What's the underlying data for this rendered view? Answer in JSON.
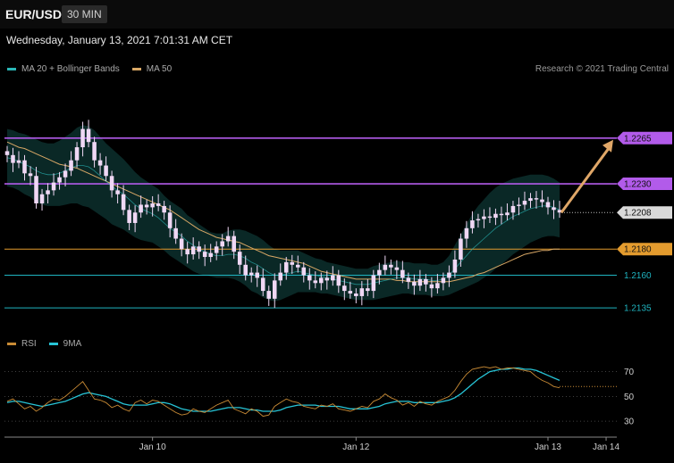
{
  "header": {
    "symbol": "EUR/USD",
    "timeframe": "30 MIN",
    "datetime": "Wednesday, January 13, 2021 7:01:31 AM CET",
    "credit": "Research © 2021 Trading Central"
  },
  "colors": {
    "bollinger": "#2ab7b7",
    "ma50": "#d9a866",
    "resistance": "#b25bea",
    "support_gold": "#e39b2e",
    "support_teal": "#1fb4c0",
    "candle": "#f0d8f5",
    "rsi": "#c98b35",
    "rsi_ma": "#27c4d6",
    "arrow": "#e0a768"
  },
  "chart_data": [
    {
      "type": "candlestick",
      "title": "EUR/USD 30 MIN",
      "ylim": [
        1.2118,
        1.2312
      ],
      "legend": [
        {
          "name": "MA 20 + Bollinger Bands",
          "color": "#2ab7b7"
        },
        {
          "name": "MA 50",
          "color": "#d9a866"
        }
      ],
      "x_ticks": [
        {
          "label": "Jan 10",
          "index": 25
        },
        {
          "label": "Jan 12",
          "index": 60
        },
        {
          "label": "Jan 13",
          "index": 93
        },
        {
          "label": "Jan 14",
          "index": 103
        }
      ],
      "close": [
        1.2252,
        1.2246,
        1.2248,
        1.2238,
        1.2236,
        1.2215,
        1.2222,
        1.2225,
        1.2231,
        1.2235,
        1.224,
        1.2248,
        1.2258,
        1.2272,
        1.2262,
        1.2248,
        1.2244,
        1.2236,
        1.2225,
        1.2222,
        1.221,
        1.22,
        1.2208,
        1.2214,
        1.2212,
        1.2215,
        1.2213,
        1.2208,
        1.2196,
        1.2188,
        1.218,
        1.2176,
        1.2182,
        1.2178,
        1.2174,
        1.2177,
        1.2182,
        1.2186,
        1.219,
        1.2178,
        1.2168,
        1.216,
        1.2162,
        1.2158,
        1.2148,
        1.2142,
        1.2156,
        1.2162,
        1.217,
        1.2168,
        1.2166,
        1.216,
        1.2156,
        1.2154,
        1.2158,
        1.2156,
        1.216,
        1.2152,
        1.2148,
        1.2146,
        1.2144,
        1.215,
        1.2148,
        1.216,
        1.2164,
        1.2168,
        1.2166,
        1.2164,
        1.2158,
        1.2155,
        1.2152,
        1.2157,
        1.2153,
        1.215,
        1.2154,
        1.2158,
        1.2162,
        1.2172,
        1.2188,
        1.2196,
        1.2202,
        1.2203,
        1.2205,
        1.2204,
        1.2207,
        1.2206,
        1.2208,
        1.2213,
        1.2214,
        1.2217,
        1.2219,
        1.2218,
        1.2216,
        1.2212,
        1.221,
        1.2208
      ],
      "ma20": [
        1.225,
        1.2249,
        1.2247,
        1.2245,
        1.2243,
        1.224,
        1.2238,
        1.2237,
        1.2237,
        1.2238,
        1.224,
        1.2242,
        1.2244,
        1.2244,
        1.2243,
        1.224,
        1.2236,
        1.2232,
        1.2228,
        1.2225,
        1.2222,
        1.2218,
        1.2214,
        1.2211,
        1.2209,
        1.2207,
        1.2204,
        1.22,
        1.2196,
        1.2193,
        1.219,
        1.2186,
        1.2183,
        1.218,
        1.2178,
        1.2176,
        1.2175,
        1.2175,
        1.2176,
        1.2176,
        1.2175,
        1.2173,
        1.217,
        1.2168,
        1.2165,
        1.2162,
        1.216,
        1.216,
        1.2161,
        1.2162,
        1.2163,
        1.2162,
        1.2161,
        1.216,
        1.2159,
        1.2158,
        1.2157,
        1.2156,
        1.2155,
        1.2154,
        1.2153,
        1.2153,
        1.2153,
        1.2154,
        1.2155,
        1.2156,
        1.2157,
        1.2158,
        1.2158,
        1.2158,
        1.2157,
        1.2157,
        1.2157,
        1.2156,
        1.2156,
        1.2157,
        1.216,
        1.2165,
        1.217,
        1.2175,
        1.218,
        1.2184,
        1.2188,
        1.2192,
        1.2196,
        1.2199,
        1.2202,
        1.2205,
        1.2207,
        1.2209,
        1.2211,
        1.2212,
        1.2213,
        1.2213,
        1.2212,
        1.221
      ],
      "band_width": [
        0.0022,
        0.0022,
        0.0022,
        0.0023,
        0.0023,
        0.0024,
        0.0024,
        0.0024,
        0.0024,
        0.0025,
        0.0026,
        0.0027,
        0.0029,
        0.0031,
        0.0031,
        0.0031,
        0.003,
        0.0029,
        0.0029,
        0.0028,
        0.0027,
        0.0026,
        0.0025,
        0.0024,
        0.0023,
        0.0022,
        0.0022,
        0.0021,
        0.0021,
        0.0021,
        0.0021,
        0.002,
        0.002,
        0.0019,
        0.0018,
        0.0017,
        0.0017,
        0.0017,
        0.0018,
        0.0019,
        0.002,
        0.0021,
        0.0022,
        0.0022,
        0.0022,
        0.0021,
        0.002,
        0.0019,
        0.0018,
        0.0017,
        0.0016,
        0.0015,
        0.0014,
        0.0013,
        0.0013,
        0.0012,
        0.0012,
        0.0012,
        0.0012,
        0.0012,
        0.0012,
        0.0012,
        0.0012,
        0.0013,
        0.0013,
        0.0013,
        0.0013,
        0.0013,
        0.0012,
        0.0012,
        0.0012,
        0.0012,
        0.0012,
        0.0012,
        0.0012,
        0.0013,
        0.0015,
        0.0018,
        0.0021,
        0.0024,
        0.0027,
        0.0029,
        0.003,
        0.0031,
        0.0031,
        0.0031,
        0.003,
        0.0029,
        0.0028,
        0.0027,
        0.0026,
        0.0025,
        0.0024,
        0.0023,
        0.0022,
        0.0021
      ],
      "ma50": [
        1.2262,
        1.226,
        1.2258,
        1.2257,
        1.2255,
        1.2253,
        1.2251,
        1.2249,
        1.2247,
        1.2245,
        1.2244,
        1.2243,
        1.2242,
        1.224,
        1.2238,
        1.2236,
        1.2234,
        1.2232,
        1.223,
        1.2228,
        1.2226,
        1.2224,
        1.2222,
        1.222,
        1.2218,
        1.2216,
        1.2214,
        1.2212,
        1.221,
        1.2207,
        1.2204,
        1.2201,
        1.2198,
        1.2195,
        1.2193,
        1.2191,
        1.2189,
        1.2188,
        1.2187,
        1.2186,
        1.2185,
        1.2183,
        1.2181,
        1.2179,
        1.2177,
        1.2175,
        1.2174,
        1.2173,
        1.2172,
        1.2171,
        1.217,
        1.2169,
        1.2167,
        1.2165,
        1.2163,
        1.2162,
        1.2161,
        1.216,
        1.2159,
        1.2158,
        1.2157,
        1.2157,
        1.2157,
        1.2157,
        1.2157,
        1.2157,
        1.2157,
        1.2156,
        1.2156,
        1.2155,
        1.2155,
        1.2155,
        1.2155,
        1.2155,
        1.2155,
        1.2155,
        1.2155,
        1.2156,
        1.2157,
        1.2158,
        1.2159,
        1.2161,
        1.2162,
        1.2164,
        1.2166,
        1.2168,
        1.217,
        1.2172,
        1.2174,
        1.2176,
        1.2177,
        1.2178,
        1.2179,
        1.2179,
        1.218,
        1.218
      ],
      "levels": [
        {
          "value": 1.2265,
          "label": "1.2265",
          "kind": "resistance",
          "color": "#b25bea"
        },
        {
          "value": 1.223,
          "label": "1.2230",
          "kind": "resistance",
          "color": "#b25bea"
        },
        {
          "value": 1.2208,
          "label": "1.2208",
          "kind": "current",
          "color": "#d9d9d9"
        },
        {
          "value": 1.218,
          "label": "1.2180",
          "kind": "support",
          "color": "#e39b2e"
        },
        {
          "value": 1.216,
          "label": "1.2160",
          "kind": "support",
          "color": "#1fb4c0"
        },
        {
          "value": 1.2135,
          "label": "1.2135",
          "kind": "support",
          "color": "#1fb4c0"
        }
      ],
      "forecast_arrow": {
        "from": 1.2208,
        "to": 1.2265
      }
    },
    {
      "type": "line",
      "legend": [
        {
          "name": "RSI",
          "color": "#c98b35"
        },
        {
          "name": "9MA",
          "color": "#27c4d6"
        }
      ],
      "ylim": [
        20,
        82
      ],
      "y_ticks": [
        "70",
        "50",
        "30"
      ],
      "y_tick_values": [
        70,
        50,
        30
      ],
      "series": [
        {
          "name": "RSI",
          "values": [
            46,
            48,
            44,
            40,
            42,
            38,
            41,
            45,
            48,
            47,
            50,
            54,
            58,
            62,
            55,
            48,
            47,
            45,
            41,
            43,
            40,
            38,
            45,
            47,
            44,
            47,
            46,
            43,
            40,
            37,
            35,
            36,
            40,
            38,
            37,
            40,
            43,
            45,
            47,
            40,
            38,
            36,
            40,
            38,
            34,
            35,
            42,
            45,
            48,
            46,
            45,
            42,
            41,
            40,
            43,
            42,
            44,
            40,
            39,
            38,
            40,
            42,
            41,
            46,
            48,
            52,
            49,
            47,
            43,
            45,
            42,
            46,
            44,
            43,
            46,
            48,
            50,
            55,
            62,
            68,
            72,
            73,
            74,
            73,
            74,
            72,
            73,
            73,
            72,
            71,
            70,
            66,
            63,
            61,
            58,
            57
          ]
        },
        {
          "name": "9MA",
          "values": [
            45,
            46,
            46,
            45,
            44,
            43,
            42,
            43,
            44,
            45,
            46,
            48,
            50,
            52,
            53,
            52,
            51,
            50,
            48,
            46,
            44,
            43,
            43,
            43,
            43,
            44,
            45,
            45,
            44,
            42,
            40,
            39,
            38,
            38,
            38,
            38,
            39,
            40,
            41,
            41,
            41,
            40,
            39,
            39,
            38,
            38,
            38,
            39,
            41,
            42,
            43,
            43,
            43,
            43,
            42,
            42,
            42,
            42,
            41,
            40,
            40,
            40,
            40,
            41,
            42,
            44,
            45,
            46,
            46,
            46,
            45,
            45,
            45,
            45,
            45,
            46,
            47,
            49,
            52,
            56,
            60,
            64,
            67,
            70,
            71,
            72,
            72,
            73,
            73,
            72,
            72,
            71,
            69,
            67,
            65,
            63
          ]
        }
      ],
      "last_value": 58
    }
  ]
}
